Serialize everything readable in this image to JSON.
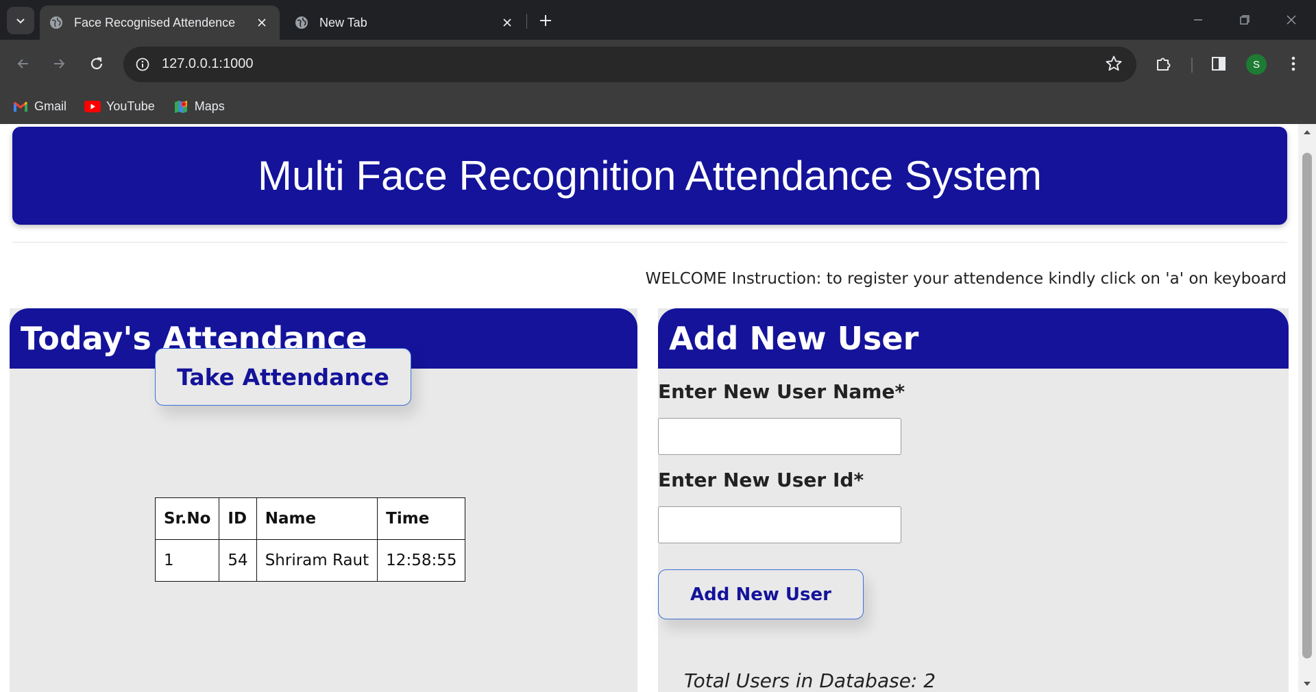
{
  "browser": {
    "tabs": [
      {
        "title": "Face Recognised Attendence",
        "active": true
      },
      {
        "title": "New Tab",
        "active": false
      }
    ],
    "url": "127.0.0.1:1000",
    "profile_initial": "S",
    "bookmarks": [
      {
        "label": "Gmail",
        "icon": "gmail-icon"
      },
      {
        "label": "YouTube",
        "icon": "youtube-icon"
      },
      {
        "label": "Maps",
        "icon": "maps-icon"
      }
    ]
  },
  "page": {
    "banner_title": "Multi Face Recognition Attendance System",
    "welcome_text": "WELCOME Instruction: to register your attendence kindly click on 'a' on keyboard",
    "attendance": {
      "heading": "Today's Attendance",
      "take_button": "Take Attendance",
      "columns": [
        "Sr.No",
        "ID",
        "Name",
        "Time"
      ],
      "rows": [
        {
          "sr": "1",
          "id": "54",
          "name": "Shriram Raut",
          "time": "12:58:55"
        }
      ]
    },
    "add_user": {
      "heading": "Add New User",
      "name_label": "Enter New User Name*",
      "name_value": "",
      "id_label": "Enter New User Id*",
      "id_value": "",
      "button": "Add New User",
      "total_users": "Total Users in Database: 2"
    }
  },
  "colors": {
    "brand": "#14139a",
    "panel_bg": "#e9e9e9",
    "button_border": "#3d6fd6"
  }
}
